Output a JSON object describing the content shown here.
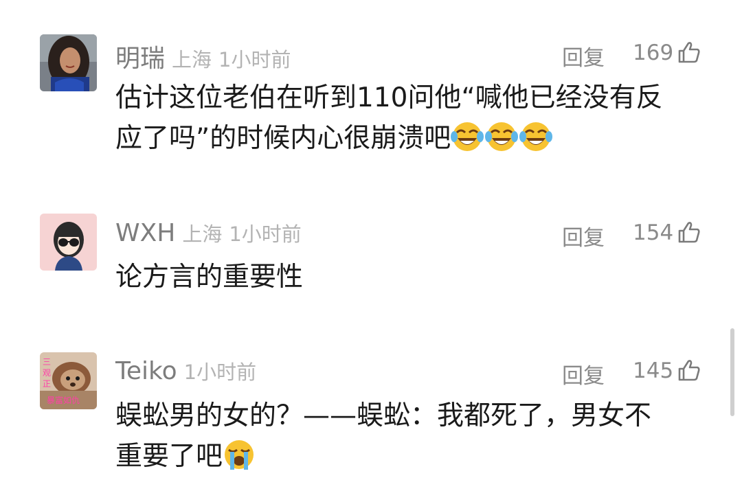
{
  "comments": [
    {
      "name": "明瑞",
      "location": "上海",
      "time": "1小时前",
      "reply_label": "回复",
      "likes": "169",
      "line1": "估计这位老伯在听到110问他“喊他已经没有反",
      "line2": "应了吗”的时候内心很崩溃吧",
      "emoji": [
        "laughing-tears-emoji",
        "laughing-tears-emoji",
        "laughing-tears-emoji"
      ]
    },
    {
      "name": "WXH",
      "location": "上海",
      "time": "1小时前",
      "reply_label": "回复",
      "likes": "154",
      "line1": "论方言的重要性"
    },
    {
      "name": "Teiko",
      "time": "1小时前",
      "reply_label": "回复",
      "likes": "145",
      "line1": "蜈蚣男的女的？——蜈蚣：我都死了，男女不",
      "line2": "重要了吧",
      "emoji": [
        "loudly-crying-emoji"
      ],
      "avatar_text": "三观正 暴富如仇"
    }
  ],
  "colors": {
    "name": "#7d7d7d",
    "meta": "#b3b3b3",
    "body": "#1a1a1a",
    "action": "#8a8a8a"
  }
}
